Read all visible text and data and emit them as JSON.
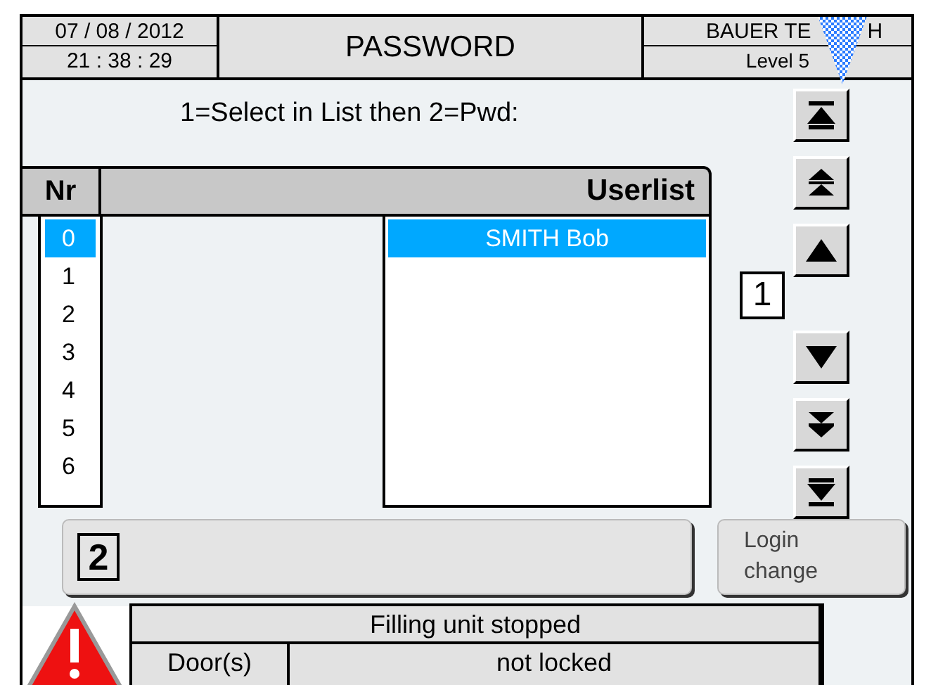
{
  "header": {
    "date": "07 / 08 / 2012",
    "time": "21 : 38 : 29",
    "title": "PASSWORD",
    "company": [
      "BAUER TE",
      "H"
    ],
    "level": "Level 5"
  },
  "instruction": "1=Select in List then 2=Pwd:",
  "table": {
    "columns": [
      "Nr",
      "Userlist"
    ],
    "numbers": [
      {
        "label": "0",
        "selected": true
      },
      {
        "label": "1",
        "selected": false
      },
      {
        "label": "2",
        "selected": false
      },
      {
        "label": "3",
        "selected": false
      },
      {
        "label": "4",
        "selected": false
      },
      {
        "label": "5",
        "selected": false
      },
      {
        "label": "6",
        "selected": false
      }
    ],
    "users": [
      {
        "name": "SMITH Bob",
        "selected": true
      }
    ]
  },
  "page_indicator": "1",
  "password_button": {
    "label": "2"
  },
  "login_button": {
    "label": "Login change"
  },
  "alarm": {
    "message": "Filling unit stopped",
    "item": "Door(s)",
    "state": "not locked"
  }
}
